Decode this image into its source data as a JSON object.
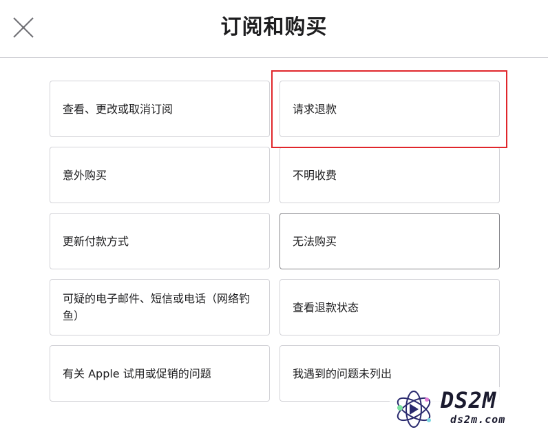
{
  "header": {
    "title": "订阅和购买",
    "close_icon": "close-icon"
  },
  "options": [
    {
      "label": "查看、更改或取消订阅"
    },
    {
      "label": "请求退款"
    },
    {
      "label": "意外购买"
    },
    {
      "label": "不明收费"
    },
    {
      "label": "更新付款方式"
    },
    {
      "label": "无法购买"
    },
    {
      "label": "可疑的电子邮件、短信或电话（网络钓鱼）"
    },
    {
      "label": "查看退款状态"
    },
    {
      "label": "有关 Apple 试用或促销的问题"
    },
    {
      "label": "我遇到的问题未列出"
    }
  ],
  "watermark": {
    "main": "DS2M",
    "sub": "ds2m.com"
  },
  "colors": {
    "highlight": "#e0262b",
    "border": "#d2d2d7",
    "focused_border": "#86868b"
  }
}
